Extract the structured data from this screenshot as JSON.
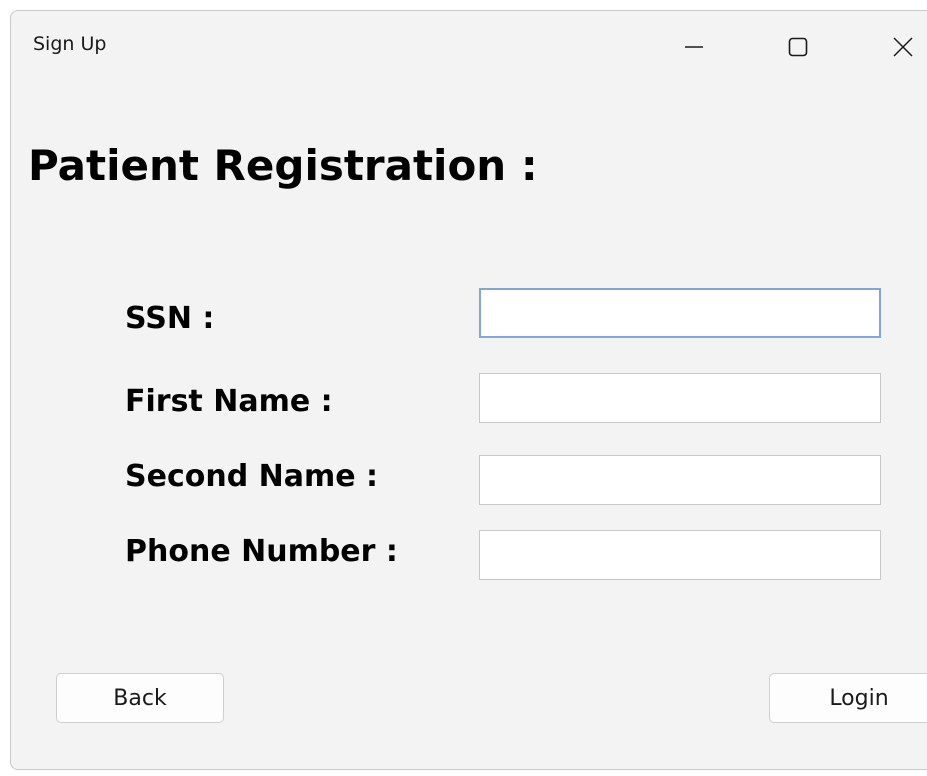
{
  "window": {
    "title": "Sign Up",
    "controls": {
      "minimize_icon": "minimize-icon",
      "maximize_icon": "maximize-icon",
      "close_icon": "close-icon"
    }
  },
  "form": {
    "heading": "Patient Registration :",
    "fields": [
      {
        "label": "SSN :",
        "value": "",
        "placeholder": ""
      },
      {
        "label": "First Name :",
        "value": "",
        "placeholder": ""
      },
      {
        "label": "Second Name :",
        "value": "",
        "placeholder": ""
      },
      {
        "label": "Phone Number :",
        "value": "",
        "placeholder": ""
      }
    ]
  },
  "buttons": {
    "back": "Back",
    "login": "Login"
  },
  "colors": {
    "window_background": "#f3f3f3",
    "focus_border": "#7ea6d8"
  }
}
